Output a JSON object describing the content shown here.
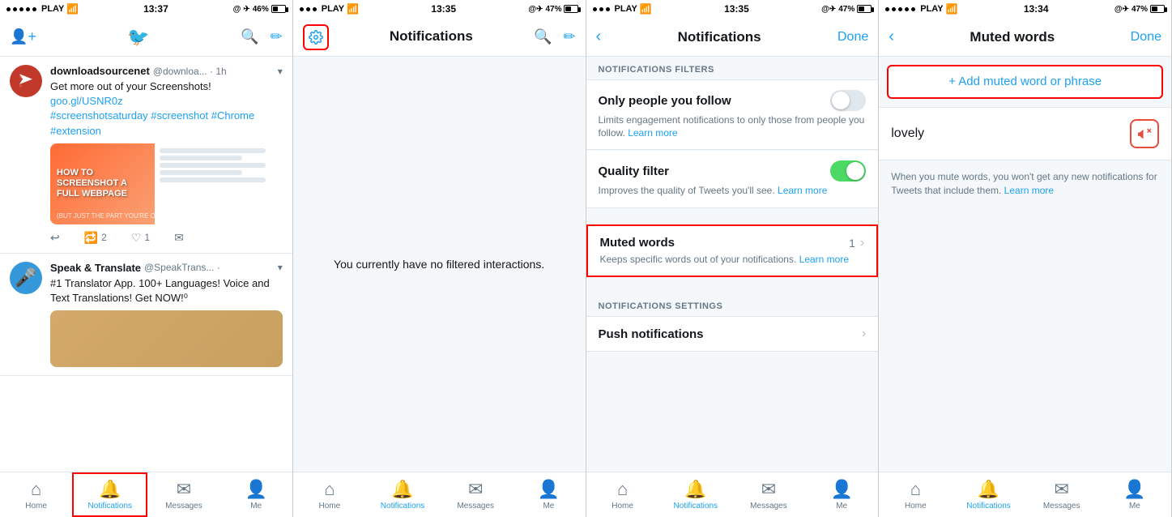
{
  "panel1": {
    "status": {
      "carrier": "PLAY",
      "time": "13:37",
      "battery": "46%"
    },
    "header": {
      "twitter_bird": "🐦"
    },
    "tweets": [
      {
        "id": "tweet1",
        "avatar_text": "⬇",
        "name": "downloadsourcenet",
        "handle": "@downloa... · 1h",
        "text": "Get more out of your Screenshots!",
        "link": "goo.gl/USNR0z",
        "hashtags": "#screenshotsaturday #screenshot #Chrome #extension",
        "has_image": true,
        "image_title": "HOW TO SCREENSHOT A FULL WEBPAGE",
        "image_sub": "(BUT JUST THE PART YOU'RE ON)"
      },
      {
        "id": "tweet2",
        "avatar_text": "🎤",
        "name": "Speak & Translate",
        "handle": "@SpeakTrans... · ",
        "text": "#1 Translator App. 100+ Languages! Voice and Text Translations! Get NOW!⁰",
        "has_image": true
      }
    ],
    "tweet_actions": [
      "↩",
      "🔁 2",
      "♡ 1",
      "✉"
    ],
    "nav": {
      "items": [
        {
          "id": "home",
          "icon": "⌂",
          "label": "Home",
          "active": false
        },
        {
          "id": "notifications",
          "icon": "🔔",
          "label": "Notifications",
          "active": false,
          "highlighted": true
        },
        {
          "id": "messages",
          "icon": "✉",
          "label": "Messages",
          "active": false
        },
        {
          "id": "me",
          "icon": "👤",
          "label": "Me",
          "active": false
        }
      ]
    }
  },
  "panel2": {
    "status": {
      "carrier": "PLAY",
      "time": "13:35",
      "battery": "47%"
    },
    "header": {
      "gear_label": "⚙",
      "title": "Notifications",
      "search_icon": "🔍",
      "compose_icon": "✏"
    },
    "empty_text": "You currently have no filtered interactions.",
    "nav": {
      "items": [
        {
          "id": "home",
          "icon": "⌂",
          "label": "Home",
          "active": false
        },
        {
          "id": "notifications",
          "icon": "🔔",
          "label": "Notifications",
          "active": true
        },
        {
          "id": "messages",
          "icon": "✉",
          "label": "Messages",
          "active": false
        },
        {
          "id": "me",
          "icon": "👤",
          "label": "Me",
          "active": false
        }
      ]
    }
  },
  "panel3": {
    "status": {
      "carrier": "PLAY",
      "time": "13:35",
      "battery": "47%"
    },
    "header": {
      "back_icon": "‹",
      "title": "Notifications",
      "done_label": "Done"
    },
    "filters_section": "NOTIFICATIONS FILTERS",
    "rows": [
      {
        "id": "follow-filter",
        "title": "Only people you follow",
        "desc": "Limits engagement notifications to only those from people you follow.",
        "link_text": "Learn more",
        "toggle": false
      },
      {
        "id": "quality-filter",
        "title": "Quality filter",
        "desc": "Improves the quality of Tweets you'll see.",
        "link_text": "Learn more",
        "toggle": true
      },
      {
        "id": "muted-words",
        "title": "Muted words",
        "count": "1",
        "highlighted": true,
        "is_nav": true
      }
    ],
    "muted_desc": "Keeps specific words out of your notifications.",
    "muted_link": "Learn more",
    "settings_section": "NOTIFICATIONS SETTINGS",
    "push_row": {
      "title": "Push notifications",
      "is_nav": true
    },
    "nav": {
      "items": [
        {
          "id": "home",
          "icon": "⌂",
          "label": "Home",
          "active": false
        },
        {
          "id": "notifications",
          "icon": "🔔",
          "label": "Notifications",
          "active": true
        },
        {
          "id": "messages",
          "icon": "✉",
          "label": "Messages",
          "active": false
        },
        {
          "id": "me",
          "icon": "👤",
          "label": "Me",
          "active": false
        }
      ]
    }
  },
  "panel4": {
    "status": {
      "carrier": "PLAY",
      "time": "13:34",
      "battery": "47%"
    },
    "header": {
      "back_icon": "‹",
      "title": "Muted words",
      "done_label": "Done"
    },
    "add_button_label": "+ Add muted word or phrase",
    "muted_word": "lovely",
    "muted_icon": "🔇",
    "desc_text": "When you mute words, you won't get any new notifications for Tweets that include them.",
    "desc_link": "Learn more",
    "nav": {
      "items": [
        {
          "id": "home",
          "icon": "⌂",
          "label": "Home",
          "active": false
        },
        {
          "id": "notifications",
          "icon": "🔔",
          "label": "Notifications",
          "active": true
        },
        {
          "id": "messages",
          "icon": "✉",
          "label": "Messages",
          "active": false
        },
        {
          "id": "me",
          "icon": "👤",
          "label": "Me",
          "active": false
        }
      ]
    }
  }
}
